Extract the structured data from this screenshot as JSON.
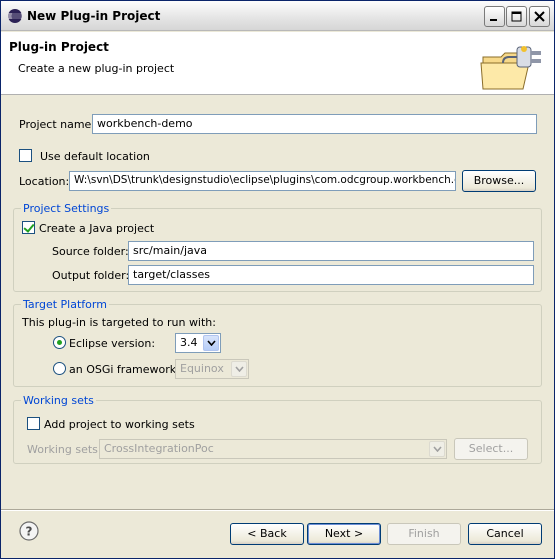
{
  "window": {
    "title": "New Plug-in Project"
  },
  "header": {
    "title": "Plug-in Project",
    "description": "Create a new plug-in project"
  },
  "form": {
    "project_name_label": "Project name:",
    "project_name_value": "workbench-demo",
    "use_default_location_label": "Use default location",
    "use_default_location_checked": false,
    "location_label": "Location:",
    "location_value": "W:\\svn\\DS\\trunk\\designstudio\\eclipse\\plugins\\com.odcgroup.workbench.demo",
    "browse_label": "Browse..."
  },
  "project_settings": {
    "title": "Project Settings",
    "create_java_label": "Create a Java project",
    "create_java_checked": true,
    "source_folder_label": "Source folder:",
    "source_folder_value": "src/main/java",
    "output_folder_label": "Output folder:",
    "output_folder_value": "target/classes"
  },
  "target_platform": {
    "title": "Target Platform",
    "intro": "This plug-in is targeted to run with:",
    "eclipse_version_label": "Eclipse version:",
    "eclipse_version_value": "3.4",
    "eclipse_selected": true,
    "osgi_label": "an OSGi framework:",
    "osgi_value": "Equinox"
  },
  "working_sets": {
    "title": "Working sets",
    "add_label": "Add project to working sets",
    "add_checked": false,
    "sets_label": "Working sets:",
    "sets_value": "CrossIntegrationPoc",
    "select_label": "Select..."
  },
  "footer": {
    "back_label": "< Back",
    "next_label": "Next >",
    "finish_label": "Finish",
    "cancel_label": "Cancel"
  },
  "colors": {
    "group_title": "#0046d5",
    "check_mark": "#21a121",
    "input_border": "#7f9db9"
  }
}
